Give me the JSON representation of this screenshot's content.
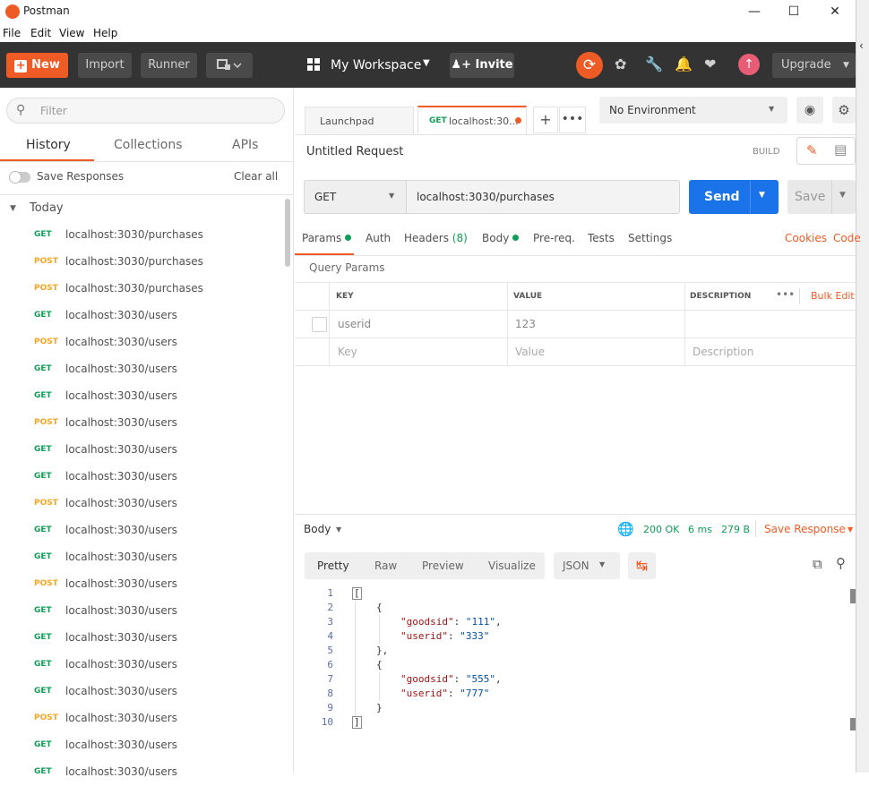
{
  "window": {
    "title": "Postman",
    "minimize": "—",
    "maximize": "☐",
    "close": "✕"
  },
  "menu": [
    "File",
    "Edit",
    "View",
    "Help"
  ],
  "toolbar": {
    "new_label": "New",
    "import_label": "Import",
    "runner_label": "Runner",
    "workspace_label": "My Workspace",
    "invite_label": "Invite",
    "upgrade_label": "Upgrade"
  },
  "sidebar": {
    "filter_placeholder": "Filter",
    "tabs": [
      "History",
      "Collections",
      "APIs"
    ],
    "save_responses": "Save Responses",
    "clear_all": "Clear all",
    "group_label": "Today",
    "history": [
      {
        "method": "GET",
        "url": "localhost:3030/purchases"
      },
      {
        "method": "POST",
        "url": "localhost:3030/purchases"
      },
      {
        "method": "POST",
        "url": "localhost:3030/purchases"
      },
      {
        "method": "GET",
        "url": "localhost:3030/users"
      },
      {
        "method": "POST",
        "url": "localhost:3030/users"
      },
      {
        "method": "GET",
        "url": "localhost:3030/users"
      },
      {
        "method": "GET",
        "url": "localhost:3030/users"
      },
      {
        "method": "POST",
        "url": "localhost:3030/users"
      },
      {
        "method": "GET",
        "url": "localhost:3030/users"
      },
      {
        "method": "GET",
        "url": "localhost:3030/users"
      },
      {
        "method": "POST",
        "url": "localhost:3030/users"
      },
      {
        "method": "GET",
        "url": "localhost:3030/users"
      },
      {
        "method": "GET",
        "url": "localhost:3030/users"
      },
      {
        "method": "POST",
        "url": "localhost:3030/users"
      },
      {
        "method": "GET",
        "url": "localhost:3030/users"
      },
      {
        "method": "GET",
        "url": "localhost:3030/users"
      },
      {
        "method": "GET",
        "url": "localhost:3030/users"
      },
      {
        "method": "GET",
        "url": "localhost:3030/users"
      },
      {
        "method": "POST",
        "url": "localhost:3030/users"
      },
      {
        "method": "GET",
        "url": "localhost:3030/users"
      },
      {
        "method": "GET",
        "url": "localhost:3030/users"
      }
    ]
  },
  "request": {
    "tabs": [
      "Launchpad",
      "localhost:30..."
    ],
    "active_tab_method": "GET",
    "environment": "No Environment",
    "name": "Untitled Request",
    "build_label": "BUILD",
    "method": "GET",
    "url": "localhost:3030/purchases",
    "send_label": "Send",
    "save_label": "Save",
    "subtabs": {
      "params": "Params",
      "auth": "Auth",
      "headers": "Headers",
      "headers_count": "(8)",
      "body": "Body",
      "prereq": "Pre-req.",
      "tests": "Tests",
      "settings": "Settings",
      "cookies": "Cookies",
      "code": "Code"
    },
    "query_params_title": "Query Params",
    "columns": {
      "key": "KEY",
      "value": "VALUE",
      "description": "DESCRIPTION",
      "bulk_edit": "Bulk Edit"
    },
    "params": [
      {
        "key": "userid",
        "value": "123"
      }
    ],
    "new_row": {
      "key": "Key",
      "value": "Value",
      "description": "Description"
    }
  },
  "response": {
    "body_label": "Body",
    "status": "200 OK",
    "time": "6 ms",
    "size": "279 B",
    "save_response": "Save Response",
    "views": [
      "Pretty",
      "Raw",
      "Preview",
      "Visualize"
    ],
    "format": "JSON",
    "lines": [
      {
        "n": "1",
        "text": "["
      },
      {
        "n": "2",
        "text": "{"
      },
      {
        "n": "3",
        "k": "\"goodsid\"",
        "v": "\"111\"",
        "sep": ","
      },
      {
        "n": "4",
        "k": "\"userid\"",
        "v": "\"333\"",
        "sep": ""
      },
      {
        "n": "5",
        "text": "},"
      },
      {
        "n": "6",
        "text": "{"
      },
      {
        "n": "7",
        "k": "\"goodsid\"",
        "v": "\"555\"",
        "sep": ","
      },
      {
        "n": "8",
        "k": "\"userid\"",
        "v": "\"777\"",
        "sep": ""
      },
      {
        "n": "9",
        "text": "}"
      },
      {
        "n": "10",
        "text": "]"
      }
    ]
  },
  "colors": {
    "accent": "#ef5b25",
    "send": "#1a73e8",
    "get": "#0f9d58",
    "post": "#f5a623"
  }
}
